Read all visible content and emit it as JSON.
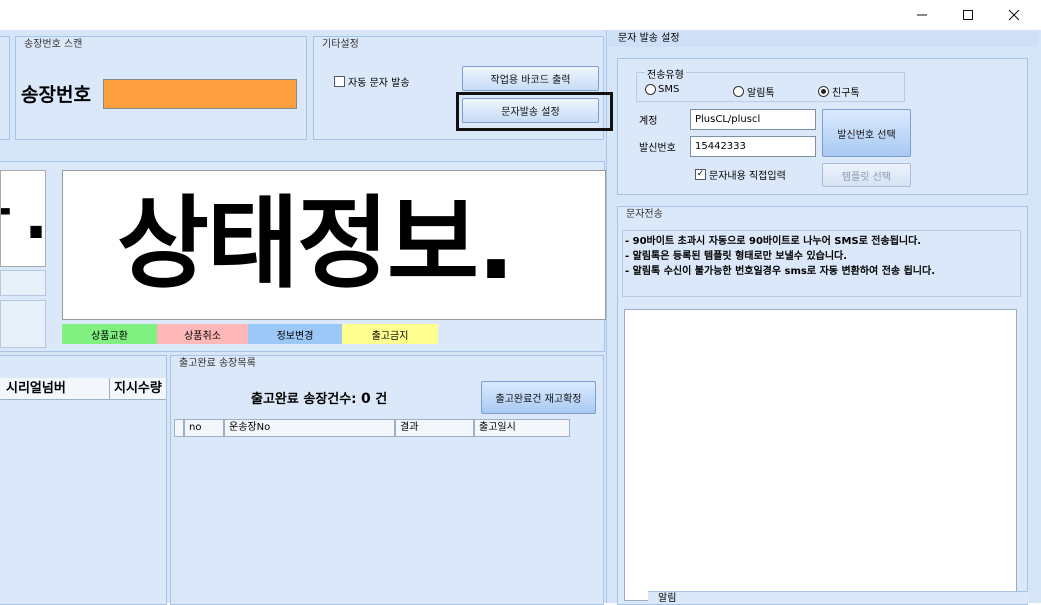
{
  "window": {
    "min_icon": "minimize-icon",
    "max_icon": "maximize-icon",
    "close_icon": "close-icon"
  },
  "scan": {
    "title": "송장번호 스캔",
    "label": "송장번호",
    "input_value": "",
    "input_color": "#ffa040"
  },
  "etc": {
    "title": "기타설정",
    "auto_sms": {
      "label": "자동 문자 발송",
      "checked": false
    },
    "print_barcode": "작업용 바코드 출력",
    "sms_settings": "문자발송 설정"
  },
  "status": {
    "left_fragment": "ㅏ.",
    "big_text": "상태정보."
  },
  "legend": [
    {
      "label": "상품교환",
      "color": "#80f080"
    },
    {
      "label": "상품취소",
      "color": "#ffb8b8"
    },
    {
      "label": "정보변경",
      "color": "#9cc8f8"
    },
    {
      "label": "출고금지",
      "color": "#ffff90"
    }
  ],
  "left_table": {
    "columns": [
      "시리얼넘버",
      "지시수량"
    ]
  },
  "shipped": {
    "title": "출고완료 송장목록",
    "count_label": "출고완료 송장건수: ",
    "count_value": "0",
    "count_unit": " 건",
    "reconfirm_button": "출고완료건 재고확정",
    "columns": [
      "no",
      "운송장No",
      "결과",
      "출고일시"
    ]
  },
  "sms_settings": {
    "title": "문자 발송 설정",
    "type_group": "전송유형",
    "options": [
      {
        "label": "SMS",
        "selected": false
      },
      {
        "label": "알림톡",
        "selected": false
      },
      {
        "label": "친구톡",
        "selected": true
      }
    ],
    "account_label": "계정",
    "account_value": "PlusCL/pluscl",
    "sender_label": "발신번호",
    "sender_value": "15442333",
    "select_sender_button": "발신번호 선택",
    "direct_input": {
      "label": "문자내용 직접입력",
      "checked": true
    },
    "template_button": "템플릿 선택"
  },
  "sms_send": {
    "title": "문자전송",
    "notes": [
      "- 90바이트 초과시 자동으로 90바이트로 나누어 SMS로 전송됩니다.",
      "- 알림톡은 등록된 템플릿 형태로만 보낼수 있습니다.",
      "- 알림톡 수신이 불가능한 번호일경우 sms로 자동 변환하여 전송 됩니다."
    ],
    "bottom_label": "알림"
  }
}
